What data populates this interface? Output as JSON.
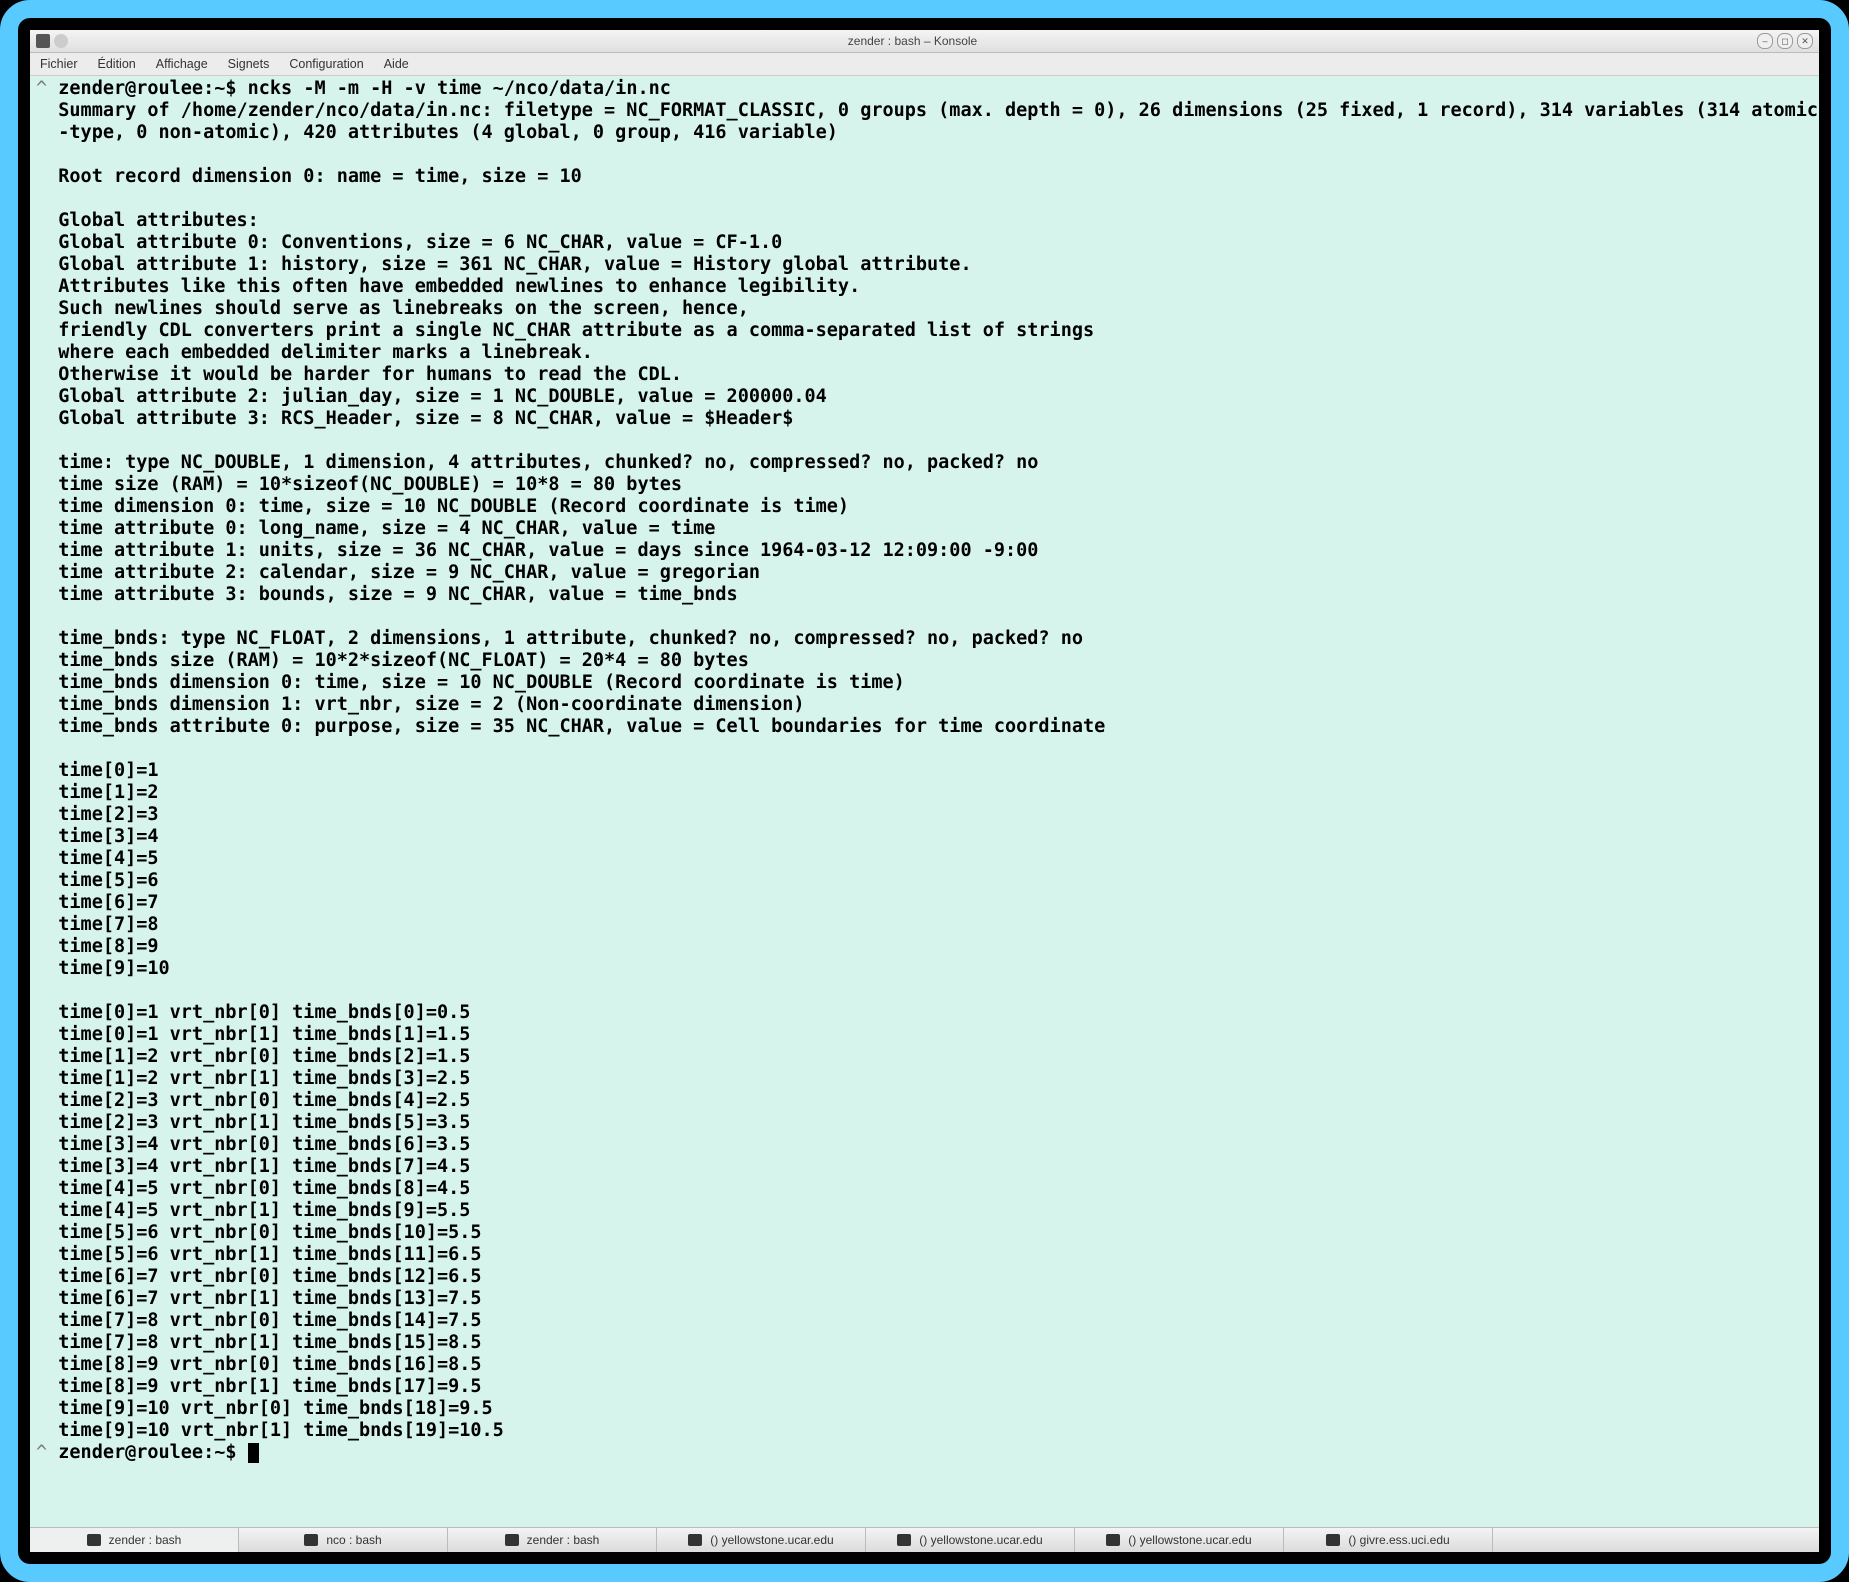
{
  "window": {
    "title": "zender : bash – Konsole"
  },
  "menu": {
    "items": [
      "Fichier",
      "Édition",
      "Affichage",
      "Signets",
      "Configuration",
      "Aide"
    ]
  },
  "prompt": "zender@roulee:~$ ",
  "command": "ncks -M -m -H -v time ~/nco/data/in.nc",
  "output_lines": [
    "Summary of /home/zender/nco/data/in.nc: filetype = NC_FORMAT_CLASSIC, 0 groups (max. depth = 0), 26 dimensions (25 fixed, 1 record), 314 variables (314 atomic",
    "-type, 0 non-atomic), 420 attributes (4 global, 0 group, 416 variable)",
    "",
    "Root record dimension 0: name = time, size = 10",
    "",
    "Global attributes:",
    "Global attribute 0: Conventions, size = 6 NC_CHAR, value = CF-1.0",
    "Global attribute 1: history, size = 361 NC_CHAR, value = History global attribute.",
    "Attributes like this often have embedded newlines to enhance legibility.",
    "Such newlines should serve as linebreaks on the screen, hence,",
    "friendly CDL converters print a single NC_CHAR attribute as a comma-separated list of strings",
    "where each embedded delimiter marks a linebreak.",
    "Otherwise it would be harder for humans to read the CDL.",
    "Global attribute 2: julian_day, size = 1 NC_DOUBLE, value = 200000.04",
    "Global attribute 3: RCS_Header, size = 8 NC_CHAR, value = $Header$",
    "",
    "time: type NC_DOUBLE, 1 dimension, 4 attributes, chunked? no, compressed? no, packed? no",
    "time size (RAM) = 10*sizeof(NC_DOUBLE) = 10*8 = 80 bytes",
    "time dimension 0: time, size = 10 NC_DOUBLE (Record coordinate is time)",
    "time attribute 0: long_name, size = 4 NC_CHAR, value = time",
    "time attribute 1: units, size = 36 NC_CHAR, value = days since 1964-03-12 12:09:00 -9:00",
    "time attribute 2: calendar, size = 9 NC_CHAR, value = gregorian",
    "time attribute 3: bounds, size = 9 NC_CHAR, value = time_bnds",
    "",
    "time_bnds: type NC_FLOAT, 2 dimensions, 1 attribute, chunked? no, compressed? no, packed? no",
    "time_bnds size (RAM) = 10*2*sizeof(NC_FLOAT) = 20*4 = 80 bytes",
    "time_bnds dimension 0: time, size = 10 NC_DOUBLE (Record coordinate is time)",
    "time_bnds dimension 1: vrt_nbr, size = 2 (Non-coordinate dimension)",
    "time_bnds attribute 0: purpose, size = 35 NC_CHAR, value = Cell boundaries for time coordinate",
    "",
    "time[0]=1",
    "time[1]=2",
    "time[2]=3",
    "time[3]=4",
    "time[4]=5",
    "time[5]=6",
    "time[6]=7",
    "time[7]=8",
    "time[8]=9",
    "time[9]=10",
    "",
    "time[0]=1 vrt_nbr[0] time_bnds[0]=0.5",
    "time[0]=1 vrt_nbr[1] time_bnds[1]=1.5",
    "time[1]=2 vrt_nbr[0] time_bnds[2]=1.5",
    "time[1]=2 vrt_nbr[1] time_bnds[3]=2.5",
    "time[2]=3 vrt_nbr[0] time_bnds[4]=2.5",
    "time[2]=3 vrt_nbr[1] time_bnds[5]=3.5",
    "time[3]=4 vrt_nbr[0] time_bnds[6]=3.5",
    "time[3]=4 vrt_nbr[1] time_bnds[7]=4.5",
    "time[4]=5 vrt_nbr[0] time_bnds[8]=4.5",
    "time[4]=5 vrt_nbr[1] time_bnds[9]=5.5",
    "time[5]=6 vrt_nbr[0] time_bnds[10]=5.5",
    "time[5]=6 vrt_nbr[1] time_bnds[11]=6.5",
    "time[6]=7 vrt_nbr[0] time_bnds[12]=6.5",
    "time[6]=7 vrt_nbr[1] time_bnds[13]=7.5",
    "time[7]=8 vrt_nbr[0] time_bnds[14]=7.5",
    "time[7]=8 vrt_nbr[1] time_bnds[15]=8.5",
    "time[8]=9 vrt_nbr[0] time_bnds[16]=8.5",
    "time[8]=9 vrt_nbr[1] time_bnds[17]=9.5",
    "time[9]=10 vrt_nbr[0] time_bnds[18]=9.5",
    "time[9]=10 vrt_nbr[1] time_bnds[19]=10.5"
  ],
  "tabs": [
    {
      "label": "zender : bash",
      "active": true
    },
    {
      "label": "nco : bash",
      "active": false
    },
    {
      "label": "zender : bash",
      "active": false
    },
    {
      "label": "() yellowstone.ucar.edu",
      "active": false
    },
    {
      "label": "() yellowstone.ucar.edu",
      "active": false
    },
    {
      "label": "() yellowstone.ucar.edu",
      "active": false
    },
    {
      "label": "() givre.ess.uci.edu",
      "active": false
    }
  ],
  "window_controls": {
    "min": "–",
    "max": "◻",
    "close": "✕"
  }
}
